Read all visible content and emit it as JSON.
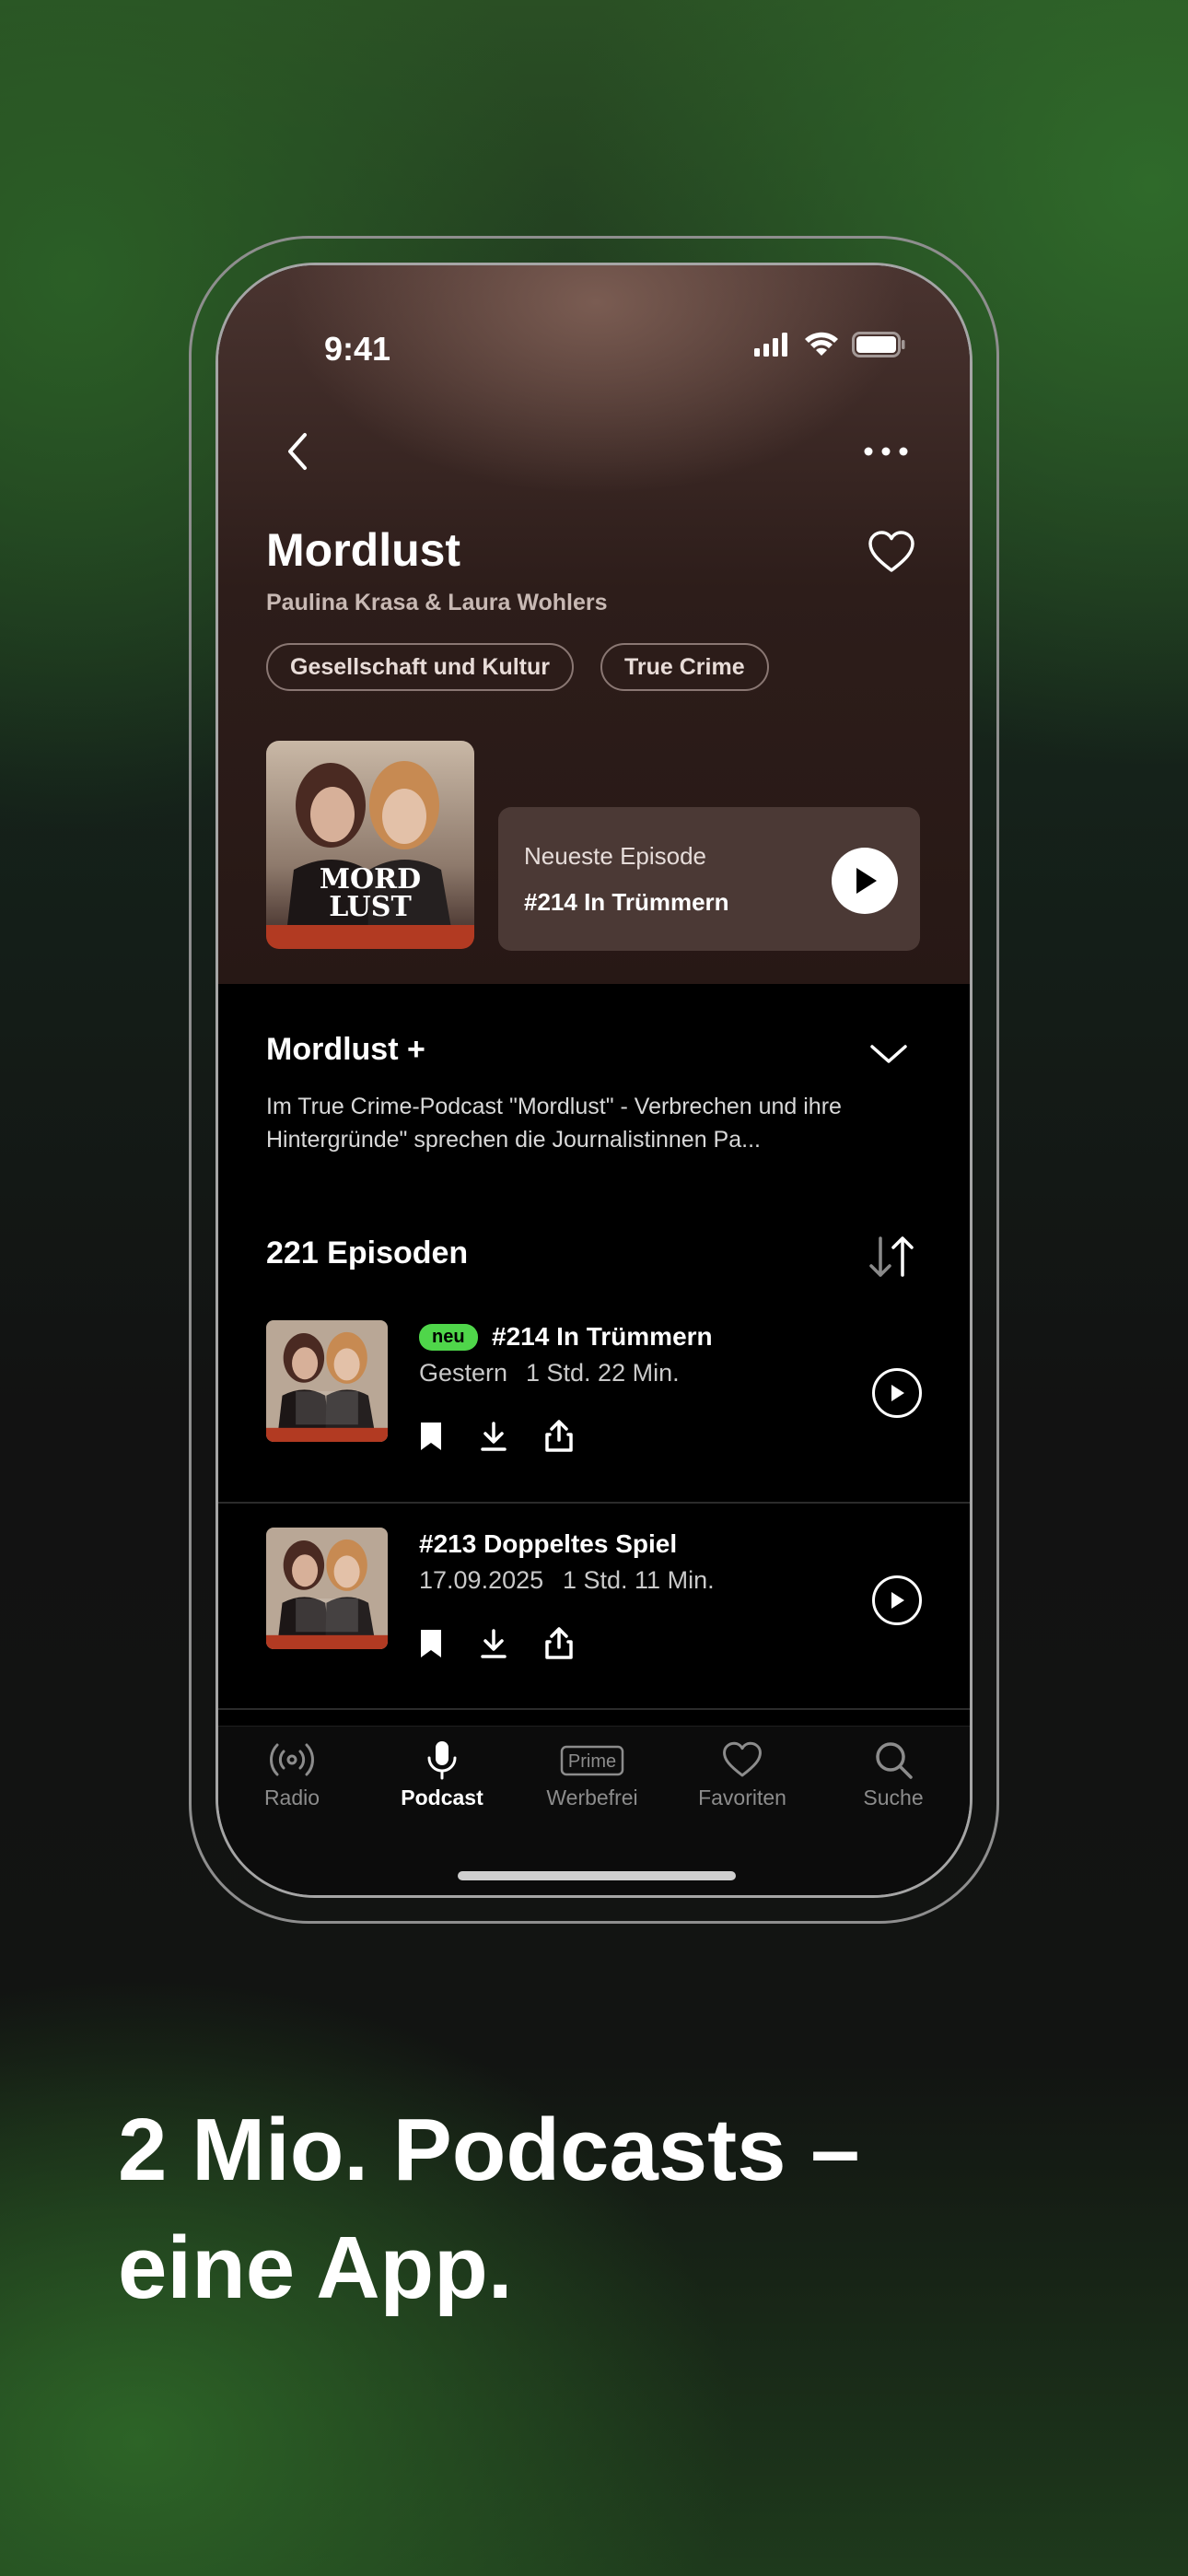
{
  "status_bar": {
    "time": "9:41"
  },
  "podcast": {
    "title": "Mordlust",
    "authors": "Paulina Krasa & Laura Wohlers",
    "categories": [
      "Gesellschaft und Kultur",
      "True Crime"
    ],
    "cover_text": [
      "MORD",
      "LUST"
    ]
  },
  "latest": {
    "label": "Neueste Episode",
    "title": "#214 In Trümmern"
  },
  "about": {
    "title": "Mordlust +",
    "description": "Im True Crime-Podcast \"Mordlust\" - Verbrechen und ihre Hintergründe\" sprechen die Journalistinnen Pa..."
  },
  "episodes_header": {
    "count_label": "221 Episoden"
  },
  "episodes": [
    {
      "badge": "neu",
      "title": "#214 In Trümmern",
      "date": "Gestern",
      "duration": "1 Std. 22 Min."
    },
    {
      "title": "#213 Doppeltes Spiel",
      "date": "17.09.2025",
      "duration": "1 Std. 11 Min."
    }
  ],
  "tabbar": [
    {
      "label": "Radio",
      "icon": "radio-icon",
      "active": false
    },
    {
      "label": "Podcast",
      "icon": "microphone-icon",
      "active": true
    },
    {
      "label": "Werbefrei",
      "icon": "prime-icon",
      "active": false,
      "icon_text": "Prime"
    },
    {
      "label": "Favoriten",
      "icon": "heart-icon",
      "active": false
    },
    {
      "label": "Suche",
      "icon": "search-icon",
      "active": false
    }
  ],
  "slogan": {
    "line1": "2 Mio. Podcasts –",
    "line2": "eine App."
  },
  "colors": {
    "badge_green": "#4fd64a",
    "hero_brown": "#4a3430",
    "accent_green": "#2f6a2a"
  }
}
